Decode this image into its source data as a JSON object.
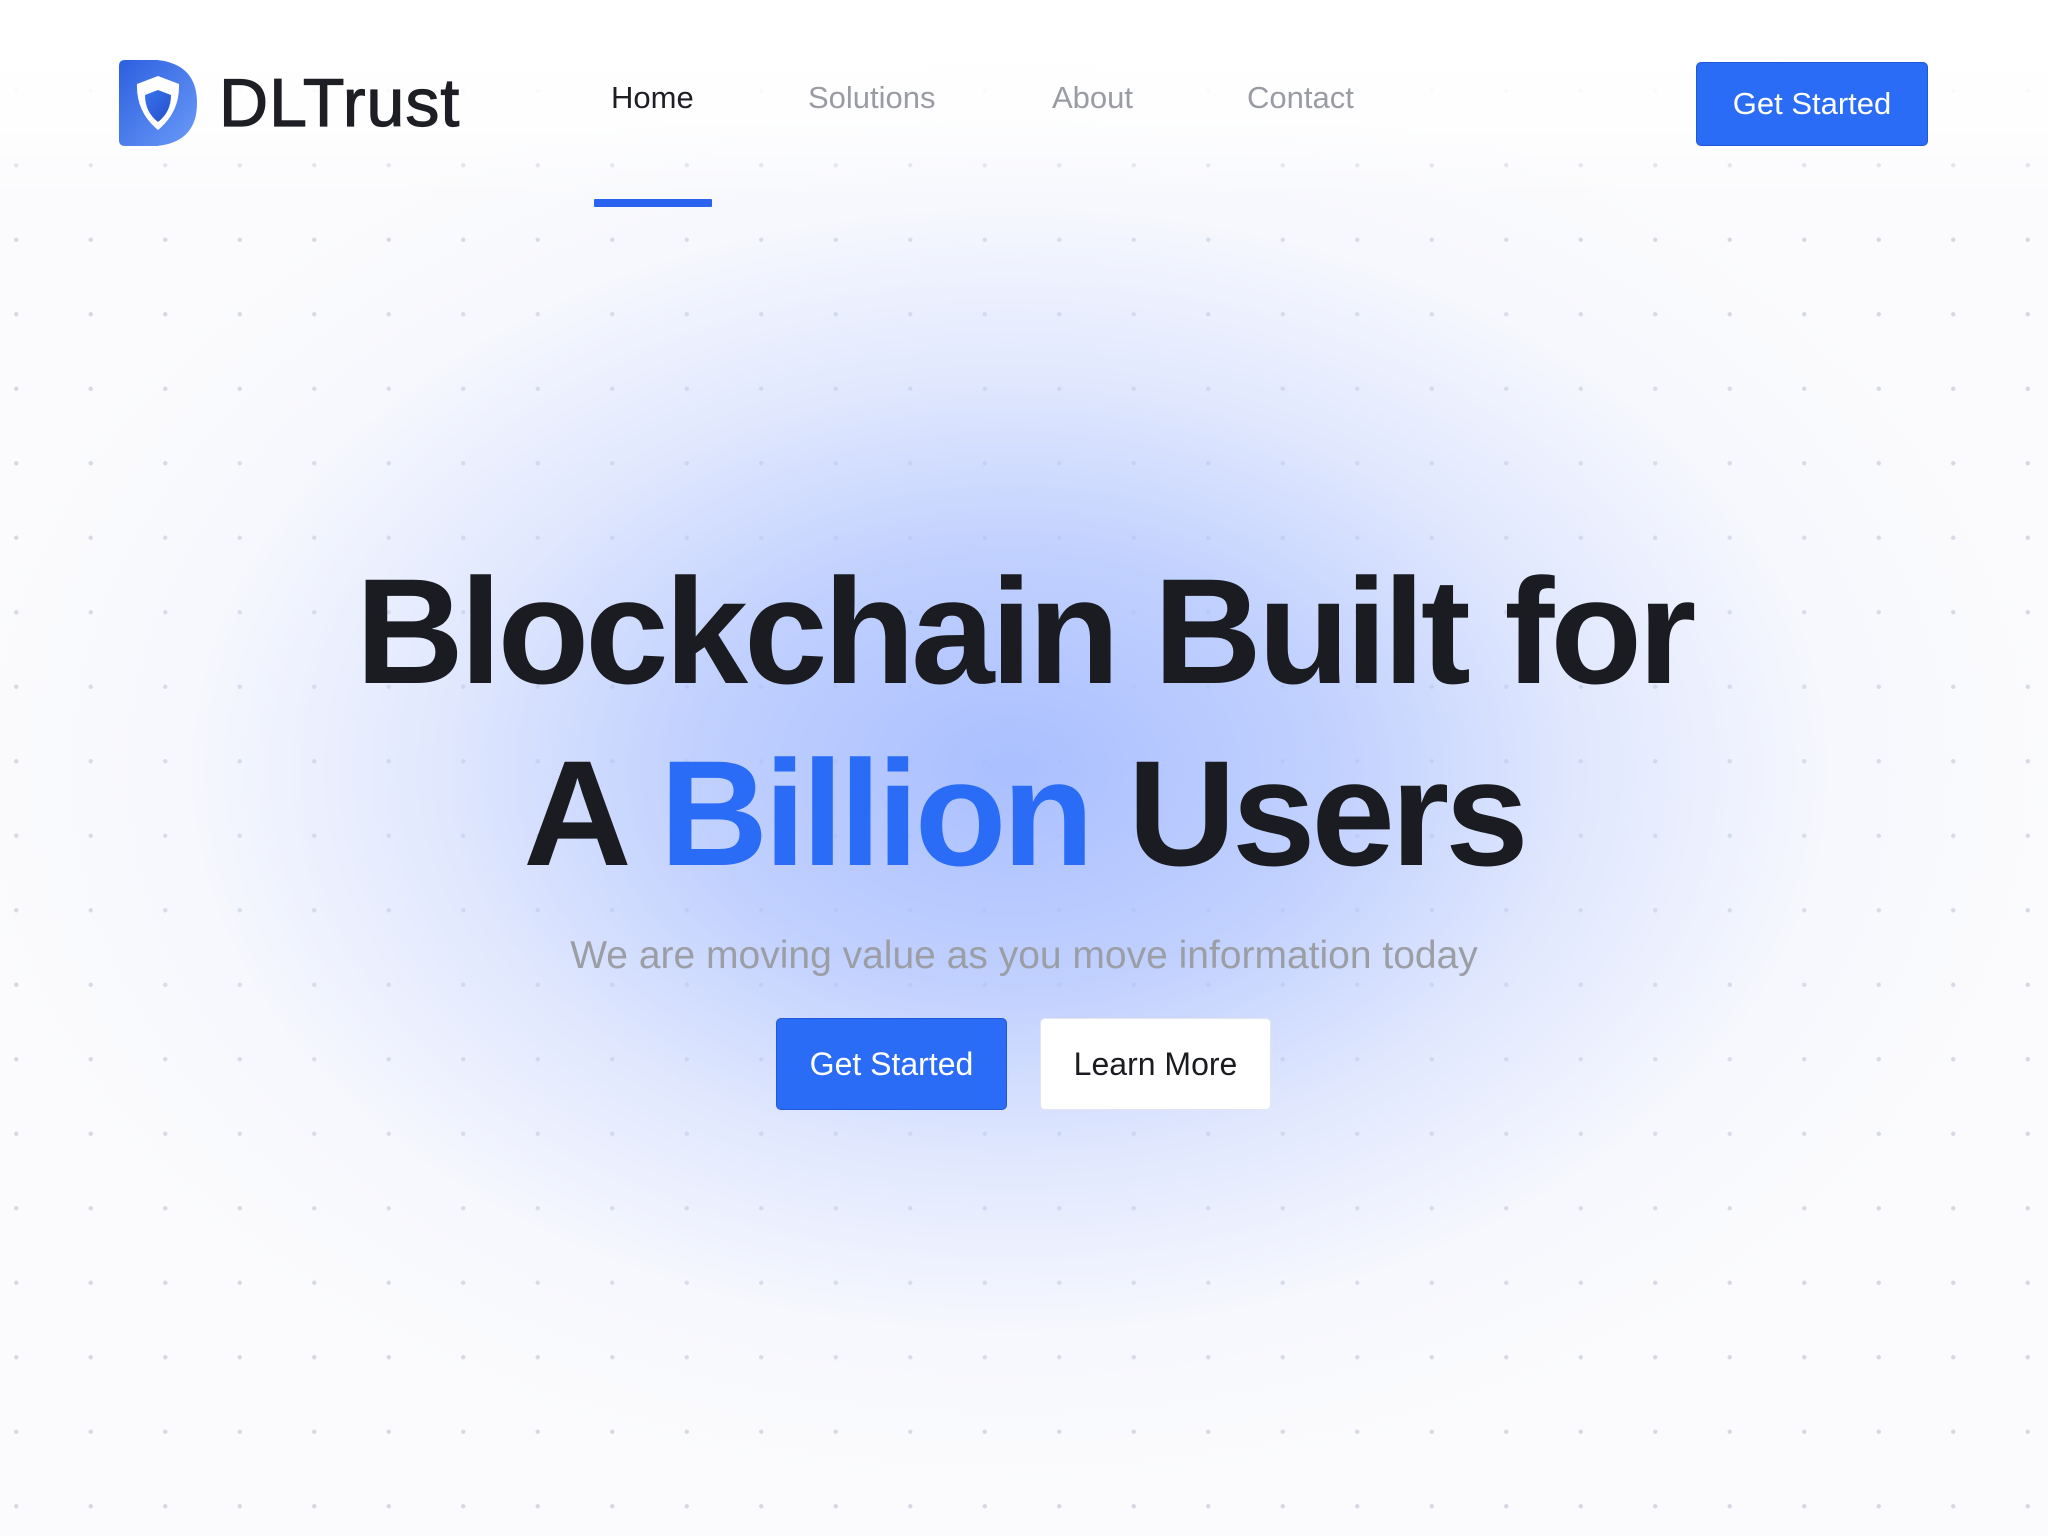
{
  "brand": {
    "name": "DLTrust",
    "logo_icon": "shield-logo-icon",
    "logo_colors": [
      "#2c64e6",
      "#5a8ff7",
      "#ffffff"
    ]
  },
  "nav": {
    "items": [
      {
        "label": "Home",
        "active": true
      },
      {
        "label": "Solutions",
        "active": false
      },
      {
        "label": "About",
        "active": false
      },
      {
        "label": "Contact",
        "active": false
      }
    ],
    "cta_label": "Get Started"
  },
  "hero": {
    "title_line1": "Blockchain Built for",
    "title_line2_prefix": "A",
    "title_line2_accent": "Billion",
    "title_line2_suffix": "Users",
    "subtitle": "We are moving value as you move information today",
    "primary_cta": "Get Started",
    "secondary_cta": "Learn More"
  },
  "colors": {
    "accent": "#2a6cf6",
    "text_dark": "#1b1c21",
    "text_muted": "#9c9ea6",
    "background": "#fbfbfd",
    "glow": "#a6bcff"
  }
}
